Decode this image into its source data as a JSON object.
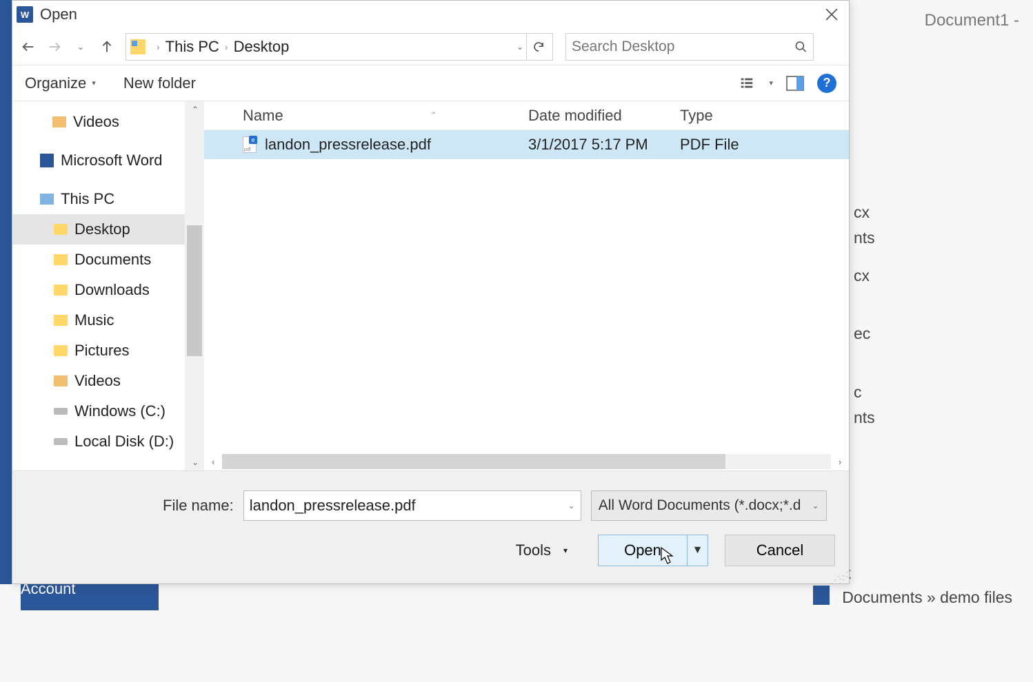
{
  "background": {
    "word_title": "Document1 -",
    "account": "Account",
    "recent_fragments": [
      "cx",
      "nts",
      "cx",
      "ec",
      "c",
      "nts"
    ],
    "recent_bottom_file": ".docx",
    "recent_bottom_path": "Documents » demo files"
  },
  "dialog": {
    "title": "Open",
    "breadcrumb": {
      "item1": "This PC",
      "item2": "Desktop"
    },
    "search_placeholder": "Search Desktop",
    "toolbar": {
      "organize": "Organize",
      "new_folder": "New folder",
      "help": "?"
    },
    "tree": {
      "items": [
        {
          "label": "Videos"
        },
        {
          "label": "Microsoft Word"
        },
        {
          "label": "This PC"
        },
        {
          "label": "Desktop"
        },
        {
          "label": "Documents"
        },
        {
          "label": "Downloads"
        },
        {
          "label": "Music"
        },
        {
          "label": "Pictures"
        },
        {
          "label": "Videos"
        },
        {
          "label": "Windows (C:)"
        },
        {
          "label": "Local Disk (D:)"
        }
      ]
    },
    "columns": {
      "name": "Name",
      "date": "Date modified",
      "type": "Type"
    },
    "files": [
      {
        "name": "landon_pressrelease.pdf",
        "date": "3/1/2017 5:17 PM",
        "type": "PDF File"
      }
    ],
    "filename_label": "File name:",
    "filename_value": "landon_pressrelease.pdf",
    "filter": "All Word Documents (*.docx;*.d",
    "buttons": {
      "tools": "Tools",
      "open": "Open",
      "cancel": "Cancel"
    }
  }
}
